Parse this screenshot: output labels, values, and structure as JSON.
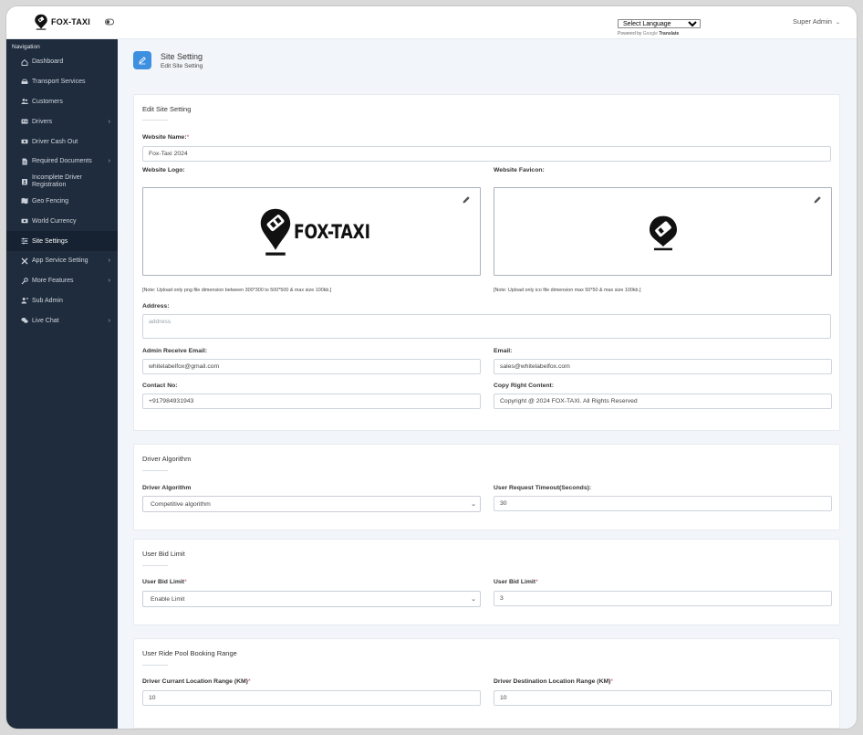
{
  "app": {
    "brand": "FOX-TAXI"
  },
  "topbar": {
    "language_select": "Select Language",
    "powered_prefix": "Powered by",
    "powered_google": "Google",
    "powered_translate": "Translate",
    "user": "Super Admin"
  },
  "sidebar": {
    "heading": "Navigation",
    "items": [
      {
        "label": "Dashboard",
        "icon": "home-icon",
        "chevron": false,
        "active": false
      },
      {
        "label": "Transport Services",
        "icon": "car-icon",
        "chevron": false,
        "active": false
      },
      {
        "label": "Customers",
        "icon": "users-icon",
        "chevron": false,
        "active": false
      },
      {
        "label": "Drivers",
        "icon": "id-card-icon",
        "chevron": true,
        "active": false
      },
      {
        "label": "Driver Cash Out",
        "icon": "money-icon",
        "chevron": false,
        "active": false
      },
      {
        "label": "Required Documents",
        "icon": "document-icon",
        "chevron": true,
        "active": false
      },
      {
        "label": "Incomplete Driver Registration",
        "icon": "user-clipboard-icon",
        "chevron": false,
        "active": false
      },
      {
        "label": "Geo Fencing",
        "icon": "map-icon",
        "chevron": false,
        "active": false
      },
      {
        "label": "World Currency",
        "icon": "currency-icon",
        "chevron": false,
        "active": false
      },
      {
        "label": "Site Settings",
        "icon": "settings-icon",
        "chevron": false,
        "active": true
      },
      {
        "label": "App Service Setting",
        "icon": "tools-icon",
        "chevron": true,
        "active": false
      },
      {
        "label": "More Features",
        "icon": "wrench-icon",
        "chevron": true,
        "active": false
      },
      {
        "label": "Sub Admin",
        "icon": "user-icon",
        "chevron": false,
        "active": false
      },
      {
        "label": "Live Chat",
        "icon": "chat-icon",
        "chevron": true,
        "active": false
      }
    ]
  },
  "page_header": {
    "title": "Site Setting",
    "subtitle": "Edit Site Setting"
  },
  "edit_site_setting": {
    "title": "Edit Site Setting",
    "website_name_label": "Website Name:",
    "website_name_value": "Fox-Taxi 2024",
    "website_logo_label": "Website Logo:",
    "website_favicon_label": "Website Favicon:",
    "logo_text": "FOX-TAXI",
    "logo_note": "[Note: Upload only png file dimension between 300*300 to 500*500 & max size 100kb.]",
    "favicon_note": "[Note: Upload only ico file dimension max 50*50 & max size 100kb.]",
    "address_label": "Address:",
    "address_placeholder": "address",
    "admin_email_label": "Admin Receive Email:",
    "admin_email_value": "whitelabelfox@gmail.com",
    "email_label": "Email:",
    "email_value": "sales@whitelabelfox.com",
    "contact_label": "Contact No:",
    "contact_value": "+917984931943",
    "copyright_label": "Copy Right Content:",
    "copyright_value": "Copyright @ 2024 FOX-TAXI. All Rights Reserved"
  },
  "driver_algorithm": {
    "title": "Driver Algorithm",
    "algorithm_label": "Driver Algorithm",
    "algorithm_value": "Competitive algorithm",
    "timeout_label": "User Request Timeout(Seconds):",
    "timeout_value": "30"
  },
  "user_bid_limit": {
    "title": "User Bid Limit",
    "select_label": "User Bid Limit",
    "select_value": "Enable Limit",
    "value_label": "User Bid Limit",
    "value_value": "3"
  },
  "ride_pool": {
    "title": "User Ride Pool Booking Range",
    "current_label": "Driver Currant Location Range (KM)",
    "current_value": "10",
    "destination_label": "Driver Destination Location Range (KM)",
    "destination_value": "10"
  },
  "colors": {
    "sidebar": "#1f2c3d",
    "accent": "#3d8fe0",
    "background": "#f2f5f9",
    "required": "#d03b3b"
  }
}
